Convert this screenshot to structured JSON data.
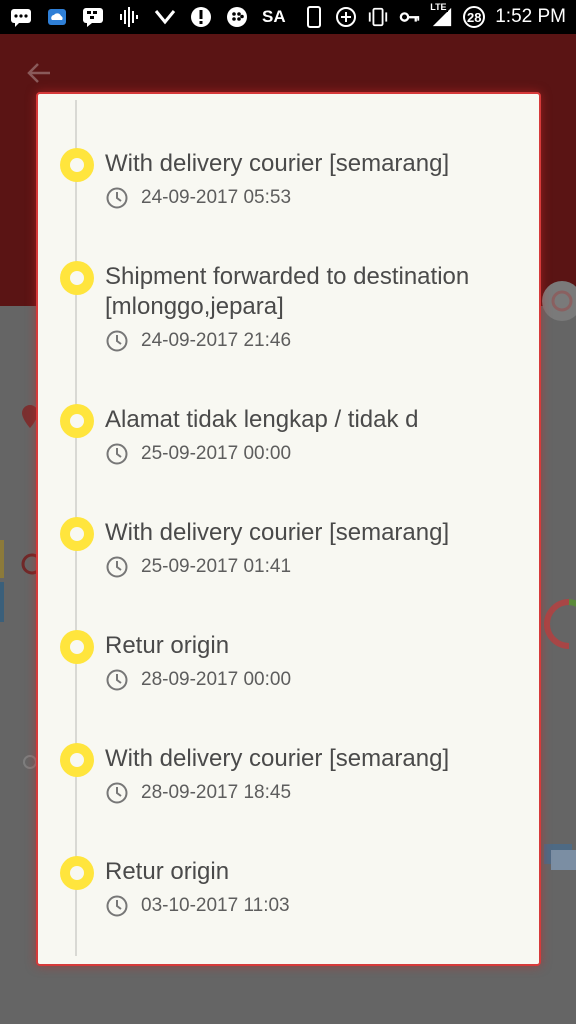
{
  "status_bar": {
    "carrier_label": "SA",
    "notification_count": "28",
    "network_label": "LTE",
    "time": "1:52 PM",
    "icons_left": [
      "chat-icon",
      "cloud-icon",
      "bbm-icon",
      "audio-wave-icon",
      "chevron-down-icon",
      "alert-icon",
      "blackberry-icon"
    ],
    "icons_right": [
      "phone-icon",
      "data-saver-icon",
      "vibrate-icon",
      "vpn-key-icon",
      "signal-icon"
    ]
  },
  "colors": {
    "accent_red": "#d63a3a",
    "timeline_dot": "#ffe53d",
    "dialog_bg": "#f8f8f2",
    "header_bg": "#5a1414"
  },
  "tracking": {
    "items": [
      {
        "status": "With delivery courier [semarang]",
        "time": "24-09-2017 05:53"
      },
      {
        "status": "Shipment forwarded to destination [mlonggo,jepara]",
        "time": "24-09-2017 21:46"
      },
      {
        "status": "Alamat tidak lengkap / tidak d",
        "time": "25-09-2017 00:00"
      },
      {
        "status": "With delivery courier [semarang]",
        "time": "25-09-2017 01:41"
      },
      {
        "status": "Retur origin",
        "time": "28-09-2017 00:00"
      },
      {
        "status": "With delivery courier [semarang]",
        "time": "28-09-2017 18:45"
      },
      {
        "status": "Retur origin",
        "time": "03-10-2017 11:03"
      }
    ]
  }
}
